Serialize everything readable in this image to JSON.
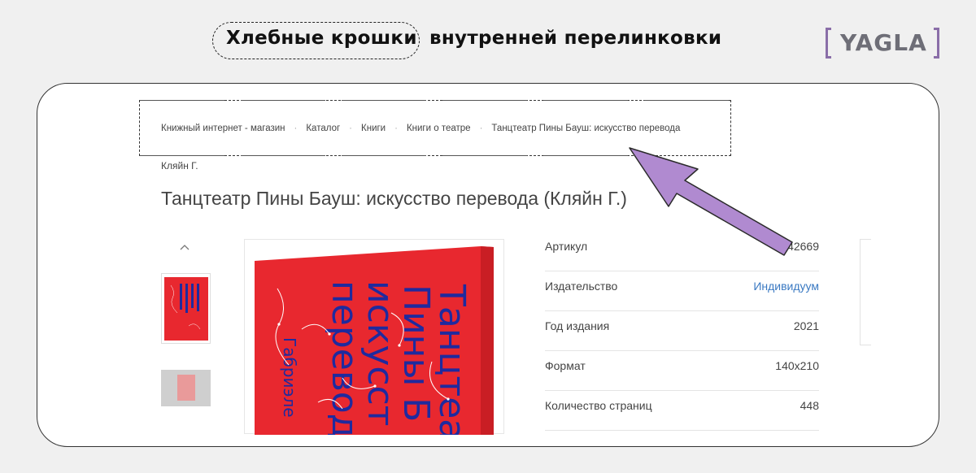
{
  "header": {
    "title_highlight": "Хлебные крошки",
    "title_rest": "внутренней перелинковки",
    "logo_text": "YAGLA"
  },
  "breadcrumbs": {
    "items": [
      "Книжный интернет - магазин",
      "Каталог",
      "Книги",
      "Книги о театре",
      "Танцтеатр Пины Бауш: искусство перевода"
    ],
    "separator": "·",
    "continuation": "Кляйн Г."
  },
  "product": {
    "title": "Танцтеатр Пины Бауш: искусство перевода (Кляйн Г.)",
    "cover_lines": [
      "Танцтеа",
      "Пины Б",
      "искусст",
      "перевод"
    ],
    "cover_author": "Габриэле"
  },
  "specs": [
    {
      "key": "Артикул",
      "value": "742669"
    },
    {
      "key": "Издательство",
      "value": "Индивидуум",
      "link": true
    },
    {
      "key": "Год издания",
      "value": "2021"
    },
    {
      "key": "Формат",
      "value": "140x210"
    },
    {
      "key": "Количество страниц",
      "value": "448"
    }
  ],
  "colors": {
    "accent_purple": "#b08ad0",
    "cover_red": "#e8282f",
    "cover_blue": "#1f2a9e",
    "link_blue": "#3a79c2"
  },
  "icons": {
    "thumb_scroll_up": "chevron-up-icon",
    "annotation_arrow": "arrow-icon"
  }
}
